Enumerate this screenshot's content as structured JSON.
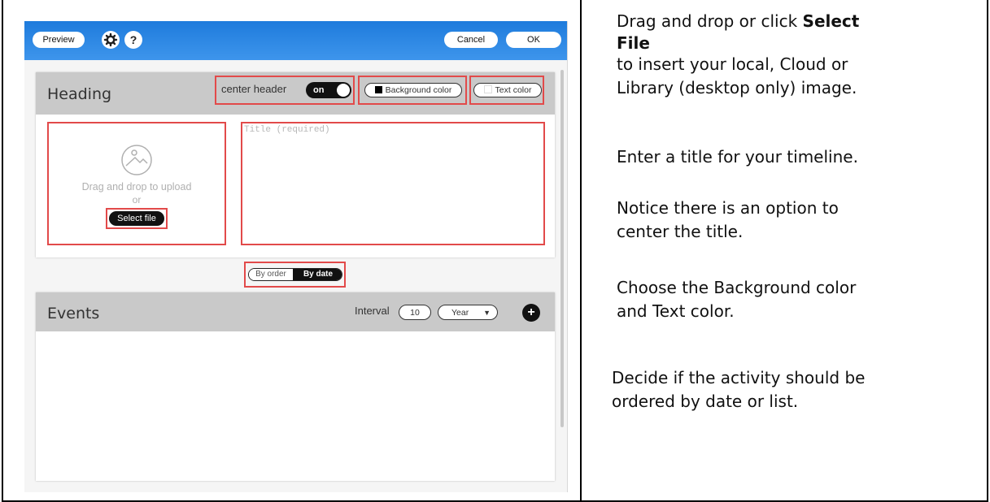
{
  "toolbar": {
    "preview_label": "Preview",
    "settings_icon": "gear-icon",
    "help_label": "?",
    "cancel_label": "Cancel",
    "ok_label": "OK"
  },
  "heading": {
    "title": "Heading",
    "center_header_label": "center header",
    "center_header_toggle": "on",
    "background_color_label": "Background color",
    "background_color": "#000000",
    "text_color_label": "Text color",
    "text_color": "#ffffff",
    "upload_text": "Drag and drop to upload",
    "upload_or": "or",
    "select_file_label": "Select file",
    "title_placeholder": "Title (required)"
  },
  "order": {
    "by_order_label": "By order",
    "by_date_label": "By date",
    "selected": "By date"
  },
  "events": {
    "title": "Events",
    "interval_label": "Interval",
    "interval_value": "10",
    "unit_value": "Year",
    "add_label": "+"
  },
  "instructions": {
    "line1_pre": "Drag and drop or click ",
    "line1_bold": "Select",
    "line2_bold": "File",
    "line3": "to insert your local, Cloud or",
    "line4": "Library (desktop only) image.",
    "line5": "Enter a title for your timeline.",
    "line6": "Notice there is an option to",
    "line7": "center the title.",
    "line8": "Choose the Background color",
    "line9": "and Text color.",
    "line10": "Decide if the activity should be",
    "line11": "ordered by date or list."
  },
  "colors": {
    "topbar": "#2f8ae6",
    "highlight": "#e24a4a",
    "panel_header": "#c9c9c9"
  }
}
